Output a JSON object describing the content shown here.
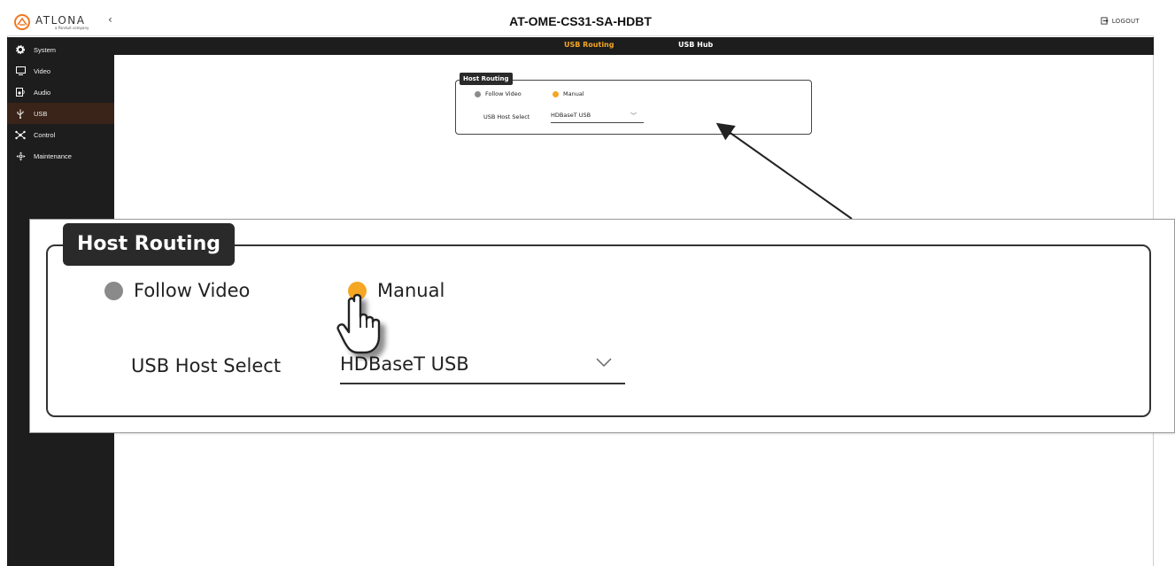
{
  "header": {
    "brand": "ATLONA",
    "brand_sub": "a Panduit company",
    "collapse_glyph": "‹",
    "device_title": "AT-OME-CS31-SA-HDBT",
    "logout_label": "LOGOUT"
  },
  "sidebar": {
    "items": [
      {
        "label": "System",
        "icon": "gear-icon"
      },
      {
        "label": "Video",
        "icon": "monitor-icon"
      },
      {
        "label": "Audio",
        "icon": "speaker-icon"
      },
      {
        "label": "USB",
        "icon": "usb-icon",
        "active": true
      },
      {
        "label": "Control",
        "icon": "network-icon"
      },
      {
        "label": "Maintenance",
        "icon": "move-arrows-icon"
      }
    ]
  },
  "tabs": [
    {
      "label": "USB Routing",
      "active": true
    },
    {
      "label": "USB Hub",
      "active": false
    }
  ],
  "host_routing": {
    "legend": "Host Routing",
    "options": [
      {
        "label": "Follow Video",
        "selected": false
      },
      {
        "label": "Manual",
        "selected": true
      }
    ],
    "usb_host_select_label": "USB Host Select",
    "usb_host_select_value": "HDBaseT USB"
  },
  "colors": {
    "accent": "#f5a623",
    "sidebar_bg": "#1d1d1d",
    "sidebar_active": "#3a2318",
    "radio_unselected": "#8a8a8a"
  }
}
